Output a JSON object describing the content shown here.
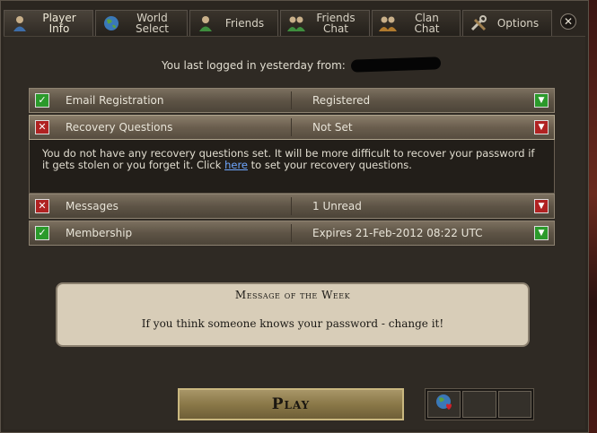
{
  "tabs": [
    {
      "label": "Player\nInfo",
      "icon": "player-icon",
      "active": true
    },
    {
      "label": "World\nSelect",
      "icon": "globe-icon",
      "active": false
    },
    {
      "label": "Friends",
      "icon": "friends-icon",
      "active": false
    },
    {
      "label": "Friends\nChat",
      "icon": "friends-chat-icon",
      "active": false
    },
    {
      "label": "Clan\nChat",
      "icon": "clan-icon",
      "active": false
    },
    {
      "label": "Options",
      "icon": "tools-icon",
      "active": false
    }
  ],
  "close_glyph": "✕",
  "last_login": "You last logged in yesterday from:",
  "rows": [
    {
      "label": "Email Registration",
      "value": "Registered",
      "status": "ok"
    },
    {
      "label": "Recovery Questions",
      "value": "Not Set",
      "status": "bad"
    },
    {
      "label": "Messages",
      "value": "1 Unread",
      "status": "bad"
    },
    {
      "label": "Membership",
      "value": "Expires 21-Feb-2012 08:22 UTC",
      "status": "ok"
    }
  ],
  "recovery_message": {
    "before": "You do not have any recovery questions set. It will be more difficult to recover your password if it gets stolen or you forget it. Click ",
    "link": "here",
    "after": " to set your recovery questions."
  },
  "motw": {
    "title": "Message of the Week",
    "text": "If you think someone knows your password - change it!"
  },
  "play_label": "Play",
  "colors": {
    "ok": "#2b9a2b",
    "bad": "#b02222",
    "link": "#6ea7ff"
  }
}
